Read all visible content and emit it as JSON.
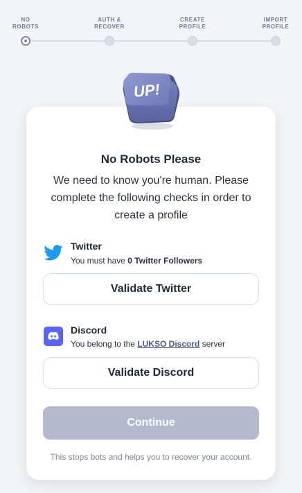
{
  "stepper": {
    "steps": [
      {
        "line1": "NO",
        "line2": "ROBOTS",
        "state": "active"
      },
      {
        "line1": "AUTH &",
        "line2": "RECOVER",
        "state": "pending"
      },
      {
        "line1": "CREATE",
        "line2": "PROFILE",
        "state": "pending"
      },
      {
        "line1": "IMPORT",
        "line2": "PROFILE",
        "state": "pending"
      }
    ]
  },
  "logo": {
    "text": "UP!"
  },
  "card": {
    "title": "No Robots Please",
    "description": "We need to know you're human. Please complete the following checks in order to create a profile",
    "twitter": {
      "icon": "twitter-bird-icon",
      "name": "Twitter",
      "req_prefix": "You must have ",
      "req_count": "0",
      "req_suffix": " Twitter Followers",
      "button": "Validate Twitter"
    },
    "discord": {
      "icon": "discord-icon",
      "name": "Discord",
      "req_prefix": "You belong to the ",
      "req_link": "LUKSO Discord",
      "req_suffix": " server",
      "button": "Validate Discord"
    },
    "continue_button": "Continue",
    "footnote": "This stops bots and helps you to recover your account."
  },
  "colors": {
    "background": "#f3f4f8",
    "twitter_blue": "#1d9bf0",
    "discord_purple": "#5865f2",
    "continue_disabled": "#b5b9cd",
    "link": "#4a5b8c"
  }
}
